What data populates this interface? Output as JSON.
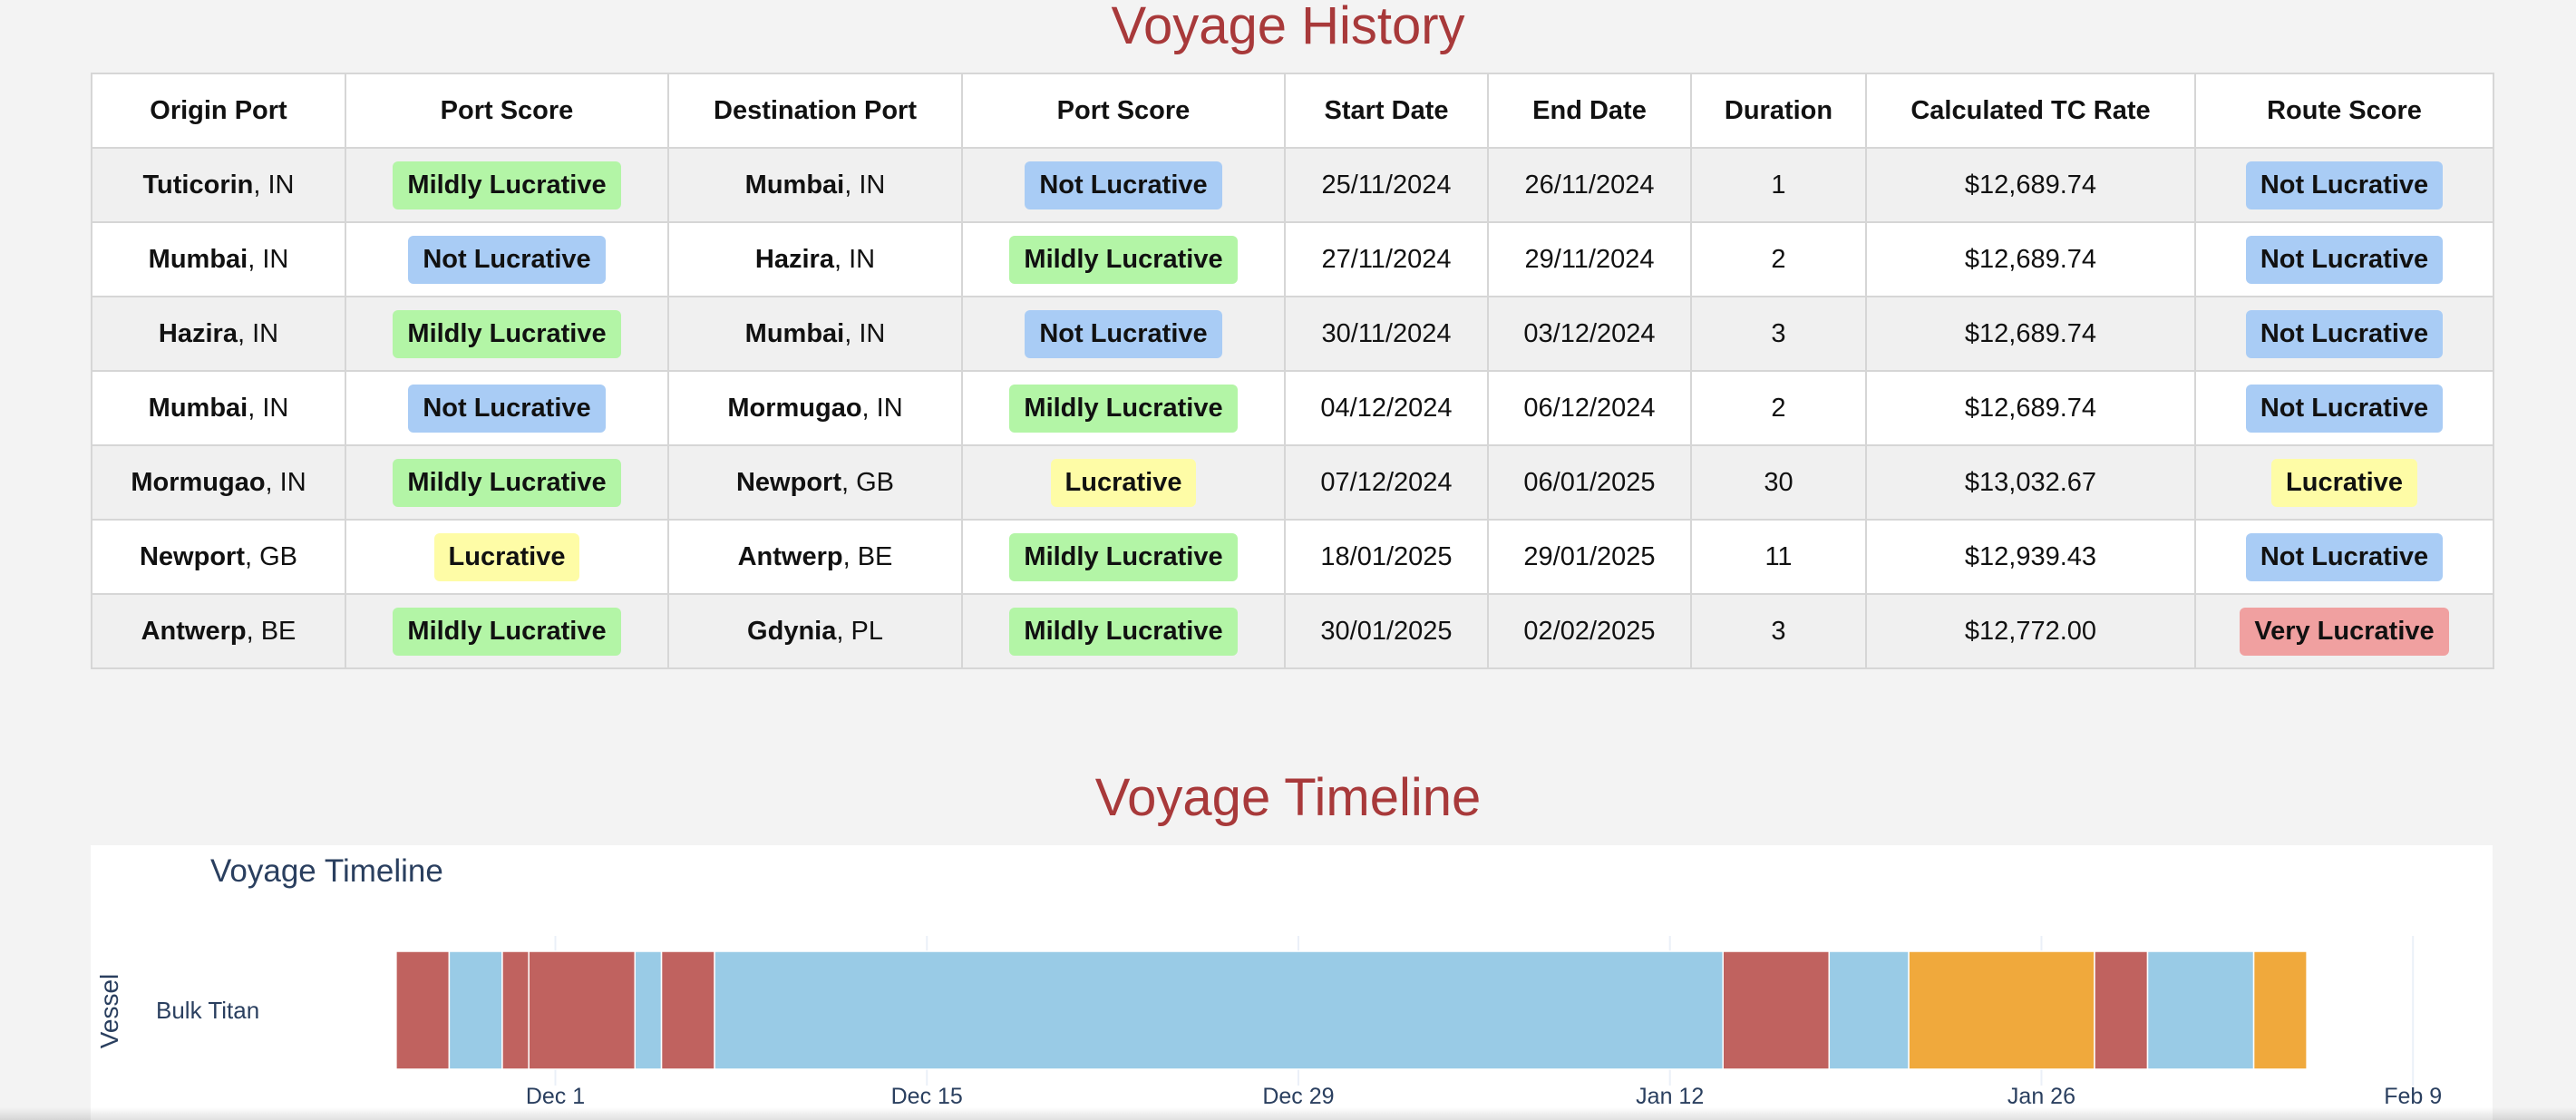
{
  "history": {
    "title": "Voyage History",
    "headers": [
      "Origin Port",
      "Port Score",
      "Destination Port",
      "Port Score",
      "Start Date",
      "End Date",
      "Duration",
      "Calculated TC Rate",
      "Route Score"
    ],
    "rows": [
      {
        "origin": {
          "name": "Tuticorin",
          "country": ", IN"
        },
        "origin_score": "Mildly Lucrative",
        "dest": {
          "name": "Mumbai",
          "country": ", IN"
        },
        "dest_score": "Not Lucrative",
        "start": "25/11/2024",
        "end": "26/11/2024",
        "duration": "1",
        "rate": "$12,689.74",
        "route_score": "Not Lucrative"
      },
      {
        "origin": {
          "name": "Mumbai",
          "country": ", IN"
        },
        "origin_score": "Not Lucrative",
        "dest": {
          "name": "Hazira",
          "country": ", IN"
        },
        "dest_score": "Mildly Lucrative",
        "start": "27/11/2024",
        "end": "29/11/2024",
        "duration": "2",
        "rate": "$12,689.74",
        "route_score": "Not Lucrative"
      },
      {
        "origin": {
          "name": "Hazira",
          "country": ", IN"
        },
        "origin_score": "Mildly Lucrative",
        "dest": {
          "name": "Mumbai",
          "country": ", IN"
        },
        "dest_score": "Not Lucrative",
        "start": "30/11/2024",
        "end": "03/12/2024",
        "duration": "3",
        "rate": "$12,689.74",
        "route_score": "Not Lucrative"
      },
      {
        "origin": {
          "name": "Mumbai",
          "country": ", IN"
        },
        "origin_score": "Not Lucrative",
        "dest": {
          "name": "Mormugao",
          "country": ", IN"
        },
        "dest_score": "Mildly Lucrative",
        "start": "04/12/2024",
        "end": "06/12/2024",
        "duration": "2",
        "rate": "$12,689.74",
        "route_score": "Not Lucrative"
      },
      {
        "origin": {
          "name": "Mormugao",
          "country": ", IN"
        },
        "origin_score": "Mildly Lucrative",
        "dest": {
          "name": "Newport",
          "country": ", GB"
        },
        "dest_score": "Lucrative",
        "start": "07/12/2024",
        "end": "06/01/2025",
        "duration": "30",
        "rate": "$13,032.67",
        "route_score": "Lucrative"
      },
      {
        "origin": {
          "name": "Newport",
          "country": ", GB"
        },
        "origin_score": "Lucrative",
        "dest": {
          "name": "Antwerp",
          "country": ", BE"
        },
        "dest_score": "Mildly Lucrative",
        "start": "18/01/2025",
        "end": "29/01/2025",
        "duration": "11",
        "rate": "$12,939.43",
        "route_score": "Not Lucrative"
      },
      {
        "origin": {
          "name": "Antwerp",
          "country": ", BE"
        },
        "origin_score": "Mildly Lucrative",
        "dest": {
          "name": "Gdynia",
          "country": ", PL"
        },
        "dest_score": "Mildly Lucrative",
        "start": "30/01/2025",
        "end": "02/02/2025",
        "duration": "3",
        "rate": "$12,772.00",
        "route_score": "Very Lucrative"
      }
    ],
    "score_colors": {
      "Mildly Lucrative": "#b3f5a6",
      "Not Lucrative": "#a9ccf5",
      "Lucrative": "#fefca6",
      "Very Lucrative": "#f0a0a0"
    }
  },
  "timeline": {
    "section_title": "Voyage Timeline"
  },
  "chart_data": {
    "type": "bar",
    "orientation": "horizontal-timeline",
    "title": "Voyage Timeline",
    "ylabel": "Vessel",
    "categories": [
      "Bulk Titan"
    ],
    "x_range": [
      "2024-11-18",
      "2025-02-12"
    ],
    "x_ticks": [
      {
        "date": "2024-12-01",
        "label": "Dec 1"
      },
      {
        "date": "2024-12-15",
        "label": "Dec 15"
      },
      {
        "date": "2024-12-29",
        "label": "Dec 29"
      },
      {
        "date": "2025-01-12",
        "label": "Jan 12"
      },
      {
        "date": "2025-01-26",
        "label": "Jan 26"
      },
      {
        "date": "2025-02-09",
        "label": "Feb 9"
      }
    ],
    "grid": true,
    "colors": {
      "red": "#c0625f",
      "blue": "#99cbe6",
      "orange": "#f0a93c"
    },
    "segments": [
      {
        "vessel": "Bulk Titan",
        "start": "2024-11-25",
        "end": "2024-11-27",
        "color": "red"
      },
      {
        "vessel": "Bulk Titan",
        "start": "2024-11-27",
        "end": "2024-11-29",
        "color": "blue"
      },
      {
        "vessel": "Bulk Titan",
        "start": "2024-11-29",
        "end": "2024-11-30",
        "color": "red"
      },
      {
        "vessel": "Bulk Titan",
        "start": "2024-11-30",
        "end": "2024-12-04",
        "color": "red"
      },
      {
        "vessel": "Bulk Titan",
        "start": "2024-12-04",
        "end": "2024-12-05",
        "color": "blue"
      },
      {
        "vessel": "Bulk Titan",
        "start": "2024-12-05",
        "end": "2024-12-07",
        "color": "red"
      },
      {
        "vessel": "Bulk Titan",
        "start": "2024-12-07",
        "end": "2025-01-14",
        "color": "blue"
      },
      {
        "vessel": "Bulk Titan",
        "start": "2025-01-14",
        "end": "2025-01-18",
        "color": "red"
      },
      {
        "vessel": "Bulk Titan",
        "start": "2025-01-18",
        "end": "2025-01-21",
        "color": "blue"
      },
      {
        "vessel": "Bulk Titan",
        "start": "2025-01-21",
        "end": "2025-01-28",
        "color": "orange"
      },
      {
        "vessel": "Bulk Titan",
        "start": "2025-01-28",
        "end": "2025-01-30",
        "color": "red"
      },
      {
        "vessel": "Bulk Titan",
        "start": "2025-01-30",
        "end": "2025-02-03",
        "color": "blue"
      },
      {
        "vessel": "Bulk Titan",
        "start": "2025-02-03",
        "end": "2025-02-05",
        "color": "orange"
      }
    ]
  }
}
